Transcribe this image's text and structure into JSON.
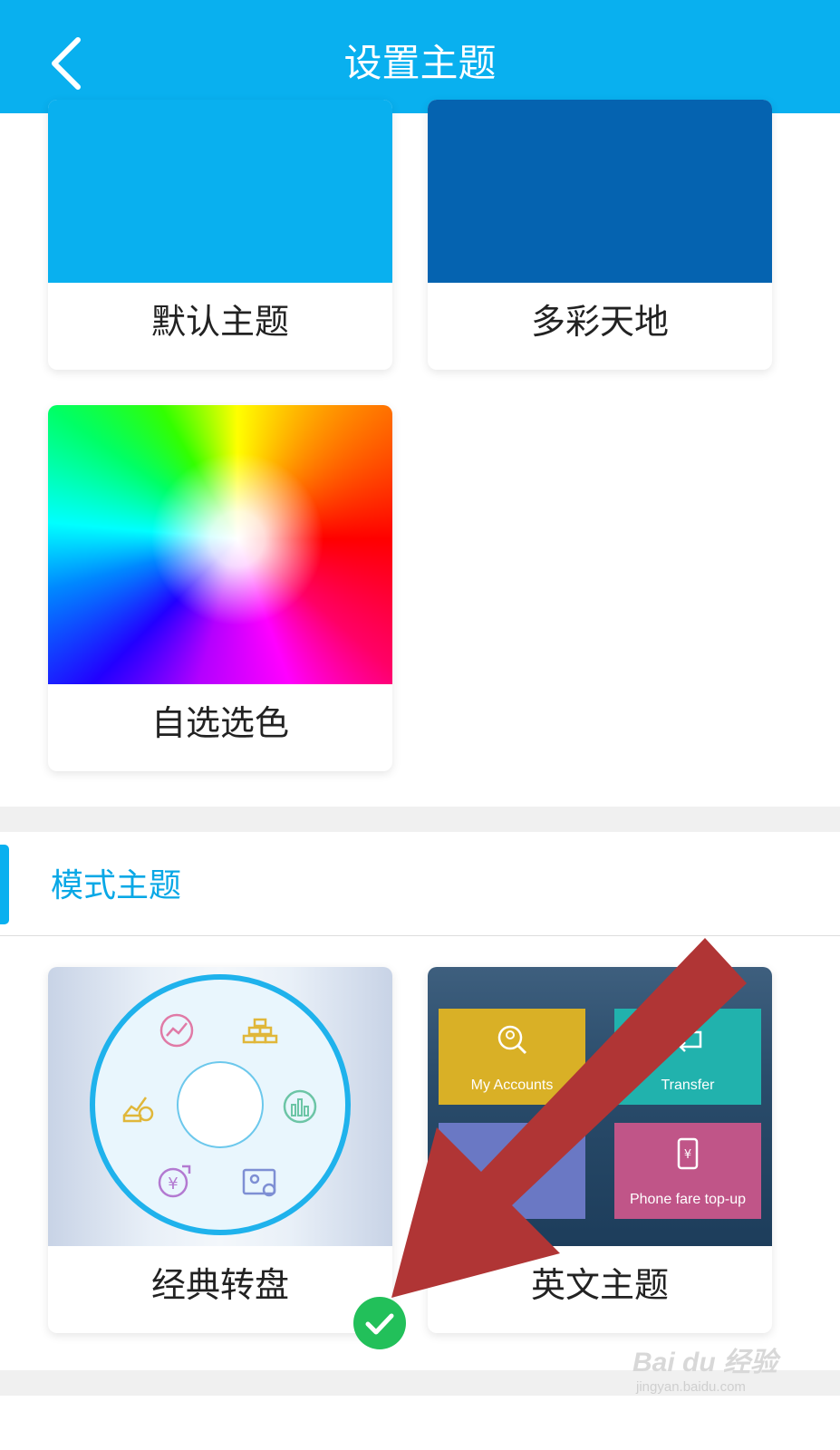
{
  "header": {
    "title": "设置主题",
    "back_icon": "chevron-left-icon"
  },
  "color_themes": [
    {
      "label": "默认主题",
      "color": "#09b0ef"
    },
    {
      "label": "多彩天地",
      "color": "#0563b0"
    },
    {
      "label": "自选选色",
      "color": "rainbow-wheel"
    }
  ],
  "mode_section": {
    "title": "模式主题",
    "accent": "#09b0ef"
  },
  "mode_themes": [
    {
      "label": "经典转盘",
      "selected": true
    },
    {
      "label": "英文主题",
      "selected": false
    }
  ],
  "english_preview": {
    "tiles": [
      {
        "label": "My Accounts",
        "color": "#d9b026",
        "icon": "account-search-icon"
      },
      {
        "label": "Transfer",
        "color": "#21b2ad",
        "icon": "transfer-icon"
      },
      {
        "label": "",
        "color": "#6a78c4",
        "icon": "card-icon"
      },
      {
        "label": "Phone fare top-up",
        "color": "#c05588",
        "icon": "phone-icon"
      }
    ]
  },
  "watermark": {
    "main": "Bai du 经验",
    "sub": "jingyan.baidu.com"
  },
  "colors": {
    "check": "#22c05a",
    "arrow": "#b03535"
  }
}
